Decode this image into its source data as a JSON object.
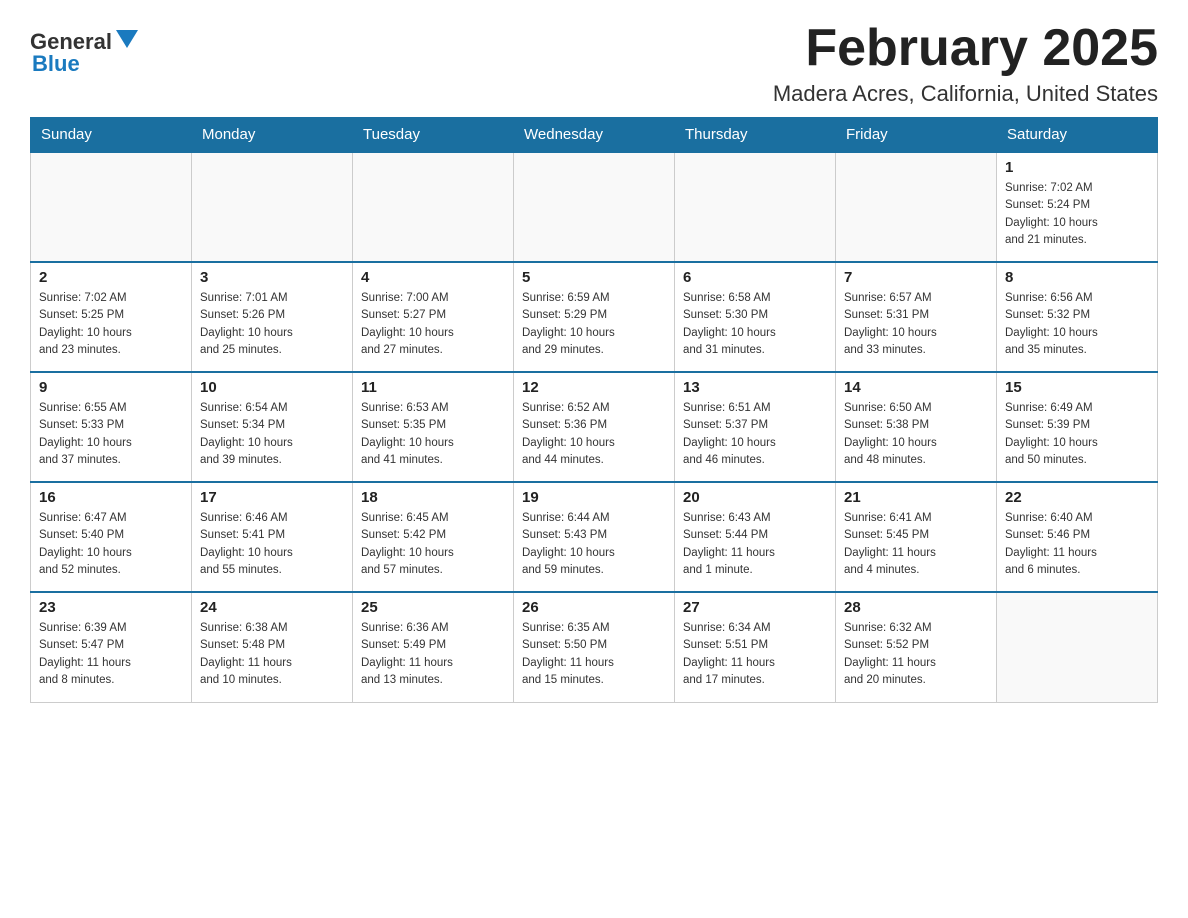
{
  "logo": {
    "text_general": "General",
    "text_blue": "Blue"
  },
  "title": "February 2025",
  "subtitle": "Madera Acres, California, United States",
  "days_of_week": [
    "Sunday",
    "Monday",
    "Tuesday",
    "Wednesday",
    "Thursday",
    "Friday",
    "Saturday"
  ],
  "weeks": [
    [
      {
        "day": "",
        "info": ""
      },
      {
        "day": "",
        "info": ""
      },
      {
        "day": "",
        "info": ""
      },
      {
        "day": "",
        "info": ""
      },
      {
        "day": "",
        "info": ""
      },
      {
        "day": "",
        "info": ""
      },
      {
        "day": "1",
        "info": "Sunrise: 7:02 AM\nSunset: 5:24 PM\nDaylight: 10 hours\nand 21 minutes."
      }
    ],
    [
      {
        "day": "2",
        "info": "Sunrise: 7:02 AM\nSunset: 5:25 PM\nDaylight: 10 hours\nand 23 minutes."
      },
      {
        "day": "3",
        "info": "Sunrise: 7:01 AM\nSunset: 5:26 PM\nDaylight: 10 hours\nand 25 minutes."
      },
      {
        "day": "4",
        "info": "Sunrise: 7:00 AM\nSunset: 5:27 PM\nDaylight: 10 hours\nand 27 minutes."
      },
      {
        "day": "5",
        "info": "Sunrise: 6:59 AM\nSunset: 5:29 PM\nDaylight: 10 hours\nand 29 minutes."
      },
      {
        "day": "6",
        "info": "Sunrise: 6:58 AM\nSunset: 5:30 PM\nDaylight: 10 hours\nand 31 minutes."
      },
      {
        "day": "7",
        "info": "Sunrise: 6:57 AM\nSunset: 5:31 PM\nDaylight: 10 hours\nand 33 minutes."
      },
      {
        "day": "8",
        "info": "Sunrise: 6:56 AM\nSunset: 5:32 PM\nDaylight: 10 hours\nand 35 minutes."
      }
    ],
    [
      {
        "day": "9",
        "info": "Sunrise: 6:55 AM\nSunset: 5:33 PM\nDaylight: 10 hours\nand 37 minutes."
      },
      {
        "day": "10",
        "info": "Sunrise: 6:54 AM\nSunset: 5:34 PM\nDaylight: 10 hours\nand 39 minutes."
      },
      {
        "day": "11",
        "info": "Sunrise: 6:53 AM\nSunset: 5:35 PM\nDaylight: 10 hours\nand 41 minutes."
      },
      {
        "day": "12",
        "info": "Sunrise: 6:52 AM\nSunset: 5:36 PM\nDaylight: 10 hours\nand 44 minutes."
      },
      {
        "day": "13",
        "info": "Sunrise: 6:51 AM\nSunset: 5:37 PM\nDaylight: 10 hours\nand 46 minutes."
      },
      {
        "day": "14",
        "info": "Sunrise: 6:50 AM\nSunset: 5:38 PM\nDaylight: 10 hours\nand 48 minutes."
      },
      {
        "day": "15",
        "info": "Sunrise: 6:49 AM\nSunset: 5:39 PM\nDaylight: 10 hours\nand 50 minutes."
      }
    ],
    [
      {
        "day": "16",
        "info": "Sunrise: 6:47 AM\nSunset: 5:40 PM\nDaylight: 10 hours\nand 52 minutes."
      },
      {
        "day": "17",
        "info": "Sunrise: 6:46 AM\nSunset: 5:41 PM\nDaylight: 10 hours\nand 55 minutes."
      },
      {
        "day": "18",
        "info": "Sunrise: 6:45 AM\nSunset: 5:42 PM\nDaylight: 10 hours\nand 57 minutes."
      },
      {
        "day": "19",
        "info": "Sunrise: 6:44 AM\nSunset: 5:43 PM\nDaylight: 10 hours\nand 59 minutes."
      },
      {
        "day": "20",
        "info": "Sunrise: 6:43 AM\nSunset: 5:44 PM\nDaylight: 11 hours\nand 1 minute."
      },
      {
        "day": "21",
        "info": "Sunrise: 6:41 AM\nSunset: 5:45 PM\nDaylight: 11 hours\nand 4 minutes."
      },
      {
        "day": "22",
        "info": "Sunrise: 6:40 AM\nSunset: 5:46 PM\nDaylight: 11 hours\nand 6 minutes."
      }
    ],
    [
      {
        "day": "23",
        "info": "Sunrise: 6:39 AM\nSunset: 5:47 PM\nDaylight: 11 hours\nand 8 minutes."
      },
      {
        "day": "24",
        "info": "Sunrise: 6:38 AM\nSunset: 5:48 PM\nDaylight: 11 hours\nand 10 minutes."
      },
      {
        "day": "25",
        "info": "Sunrise: 6:36 AM\nSunset: 5:49 PM\nDaylight: 11 hours\nand 13 minutes."
      },
      {
        "day": "26",
        "info": "Sunrise: 6:35 AM\nSunset: 5:50 PM\nDaylight: 11 hours\nand 15 minutes."
      },
      {
        "day": "27",
        "info": "Sunrise: 6:34 AM\nSunset: 5:51 PM\nDaylight: 11 hours\nand 17 minutes."
      },
      {
        "day": "28",
        "info": "Sunrise: 6:32 AM\nSunset: 5:52 PM\nDaylight: 11 hours\nand 20 minutes."
      },
      {
        "day": "",
        "info": ""
      }
    ]
  ]
}
